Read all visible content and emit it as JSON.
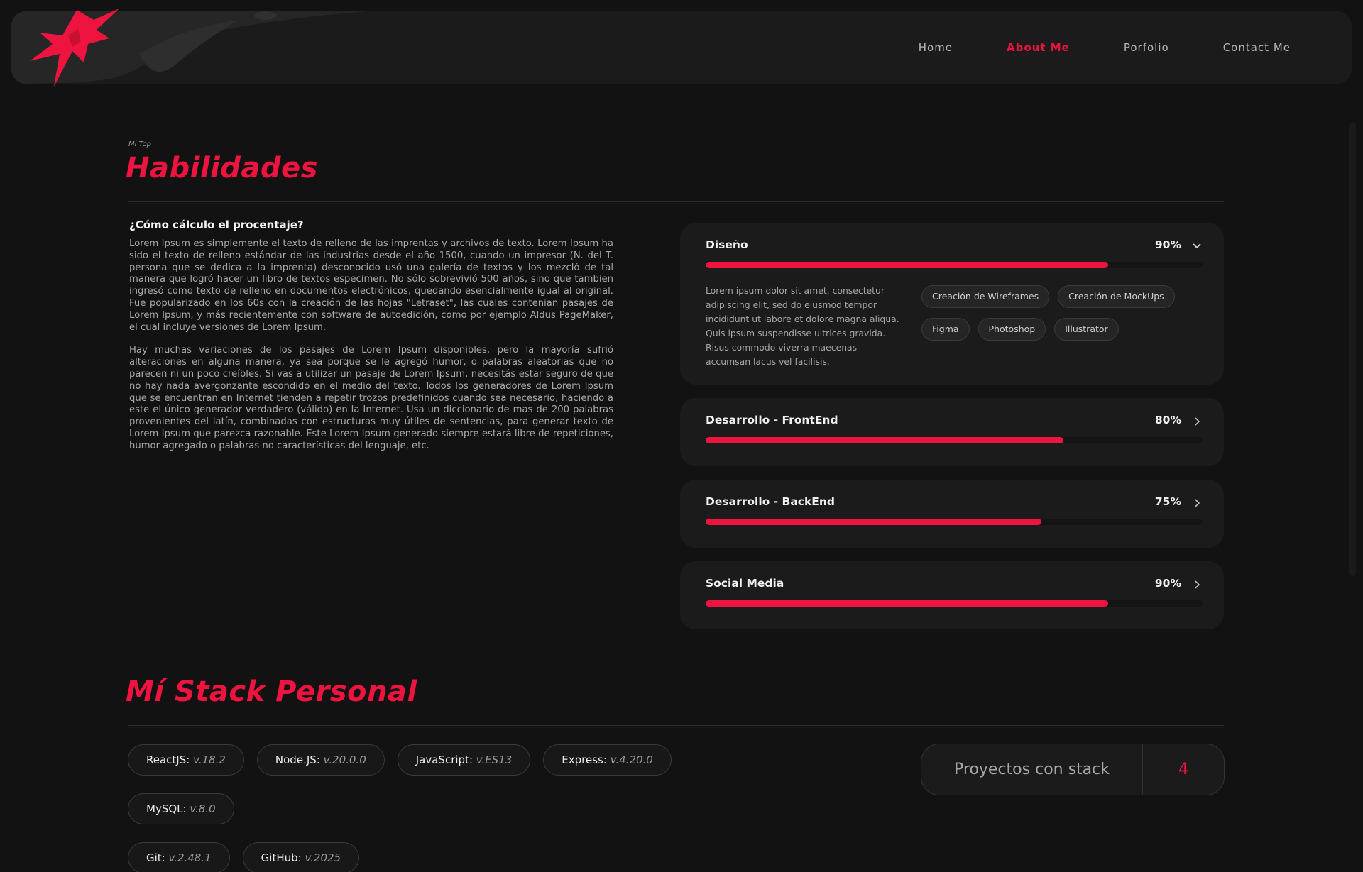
{
  "colors": {
    "accent": "#ef1440",
    "background": "#121212",
    "card": "#1b1b1b"
  },
  "nav": {
    "logo_icon": "spiky-star-logo",
    "links": [
      {
        "label": "Home",
        "active": false
      },
      {
        "label": "About Me",
        "active": true
      },
      {
        "label": "Porfolio",
        "active": false
      },
      {
        "label": "Contact Me",
        "active": false
      }
    ]
  },
  "skills_section": {
    "eyebrow": "Mi Top",
    "title": "Habilidades",
    "question": "¿Cómo cálculo el procentaje?",
    "paragraphs": [
      "Lorem Ipsum es simplemente el texto de relleno de las imprentas y archivos de texto. Lorem Ipsum ha sido el texto de relleno estándar de las industrias desde el año 1500, cuando un impresor (N. del T. persona que se dedica a la imprenta) desconocido usó una galería de textos y los mezcló de tal manera que logró hacer un libro de textos especimen. No sólo sobrevivió 500 años, sino que tambien ingresó como texto de relleno en documentos electrónicos, quedando esencialmente igual al original. Fue popularizado en los 60s con la creación de las hojas \"Letraset\", las cuales contenian pasajes de Lorem Ipsum, y más recientemente con software de autoedición, como por ejemplo Aldus PageMaker, el cual incluye versiones de Lorem Ipsum.",
      "Hay muchas variaciones de los pasajes de Lorem Ipsum disponibles, pero la mayoría sufrió alteraciones en alguna manera, ya sea porque se le agregó humor, o palabras aleatorias que no parecen ni un poco creíbles. Si vas a utilizar un pasaje de Lorem Ipsum, necesitás estar seguro de que no hay nada avergonzante escondido en el medio del texto. Todos los generadores de Lorem Ipsum que se encuentran en Internet tienden a repetir trozos predefinidos cuando sea necesario, haciendo a este el único generador verdadero (válido) en la Internet. Usa un diccionario de mas de 200 palabras provenientes del latín, combinadas con estructuras muy útiles de sentencias, para generar texto de Lorem Ipsum que parezca razonable. Este Lorem Ipsum generado siempre estará libre de repeticiones, humor agregado o palabras no características del lenguaje, etc."
    ],
    "skills": [
      {
        "name": "Diseño",
        "percent_label": "90%",
        "percent": 90,
        "expanded": true,
        "icon": "chevron-down-icon",
        "description": "Lorem ipsum dolor sit amet, consectetur adipiscing elit, sed do eiusmod tempor incididunt ut labore et dolore magna aliqua. Quis ipsum suspendisse ultrices gravida. Risus commodo viverra maecenas accumsan lacus vel facilisis.",
        "tags": [
          "Creación de Wireframes",
          "Creación de MockUps",
          "Figma",
          "Photoshop",
          "Illustrator"
        ]
      },
      {
        "name": "Desarrollo - FrontEnd",
        "percent_label": "80%",
        "percent": 80,
        "expanded": false,
        "icon": "chevron-right-icon"
      },
      {
        "name": "Desarrollo - BackEnd",
        "percent_label": "75%",
        "percent": 75,
        "expanded": false,
        "icon": "chevron-right-icon"
      },
      {
        "name": "Social Media",
        "percent_label": "90%",
        "percent": 90,
        "expanded": false,
        "icon": "chevron-right-icon"
      }
    ]
  },
  "stack_section": {
    "title": "Mí Stack Personal",
    "items": [
      {
        "name": "ReactJS:",
        "version": "v.18.2"
      },
      {
        "name": "Node.JS:",
        "version": "v.20.0.0"
      },
      {
        "name": "JavaScript:",
        "version": "v.ES13"
      },
      {
        "name": "Express:",
        "version": "v.4.20.0"
      },
      {
        "name": "MySQL:",
        "version": "v.8.0"
      },
      {
        "name": "Git:",
        "version": "v.2.48.1"
      },
      {
        "name": "GitHub:",
        "version": "v.2025"
      }
    ],
    "projects_label": "Proyectos con stack",
    "projects_count": "4"
  }
}
